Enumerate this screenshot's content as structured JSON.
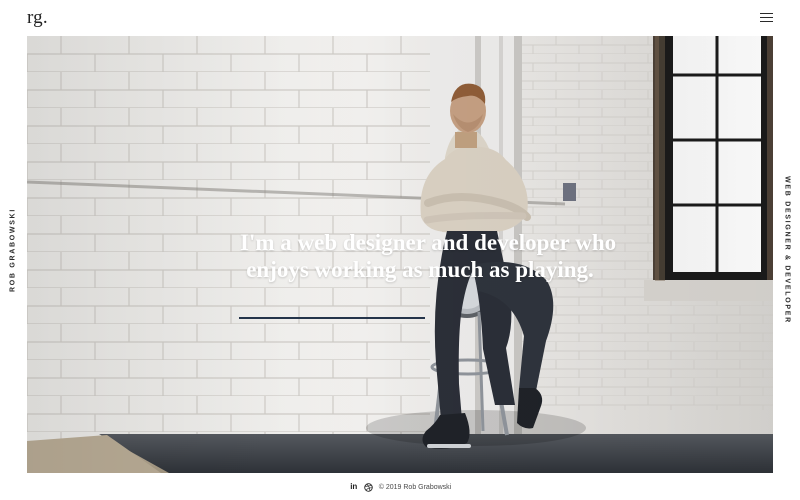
{
  "header": {
    "logo": "rg.",
    "menu_icon": "hamburger-menu-icon"
  },
  "sidebar": {
    "left_label": "ROB GRABOWSKI",
    "right_label": "WEB DESIGNER & DEVELOPER"
  },
  "hero": {
    "headline_line_1": "I'm a web designer and developer who",
    "headline_line_2": "enjoys working as much as playing.",
    "accent_color": "#24344a"
  },
  "footer": {
    "linkedin_label": "in",
    "dribbble_icon": "dribbble-icon",
    "copyright": "© 2019 Rob Grabowski"
  }
}
